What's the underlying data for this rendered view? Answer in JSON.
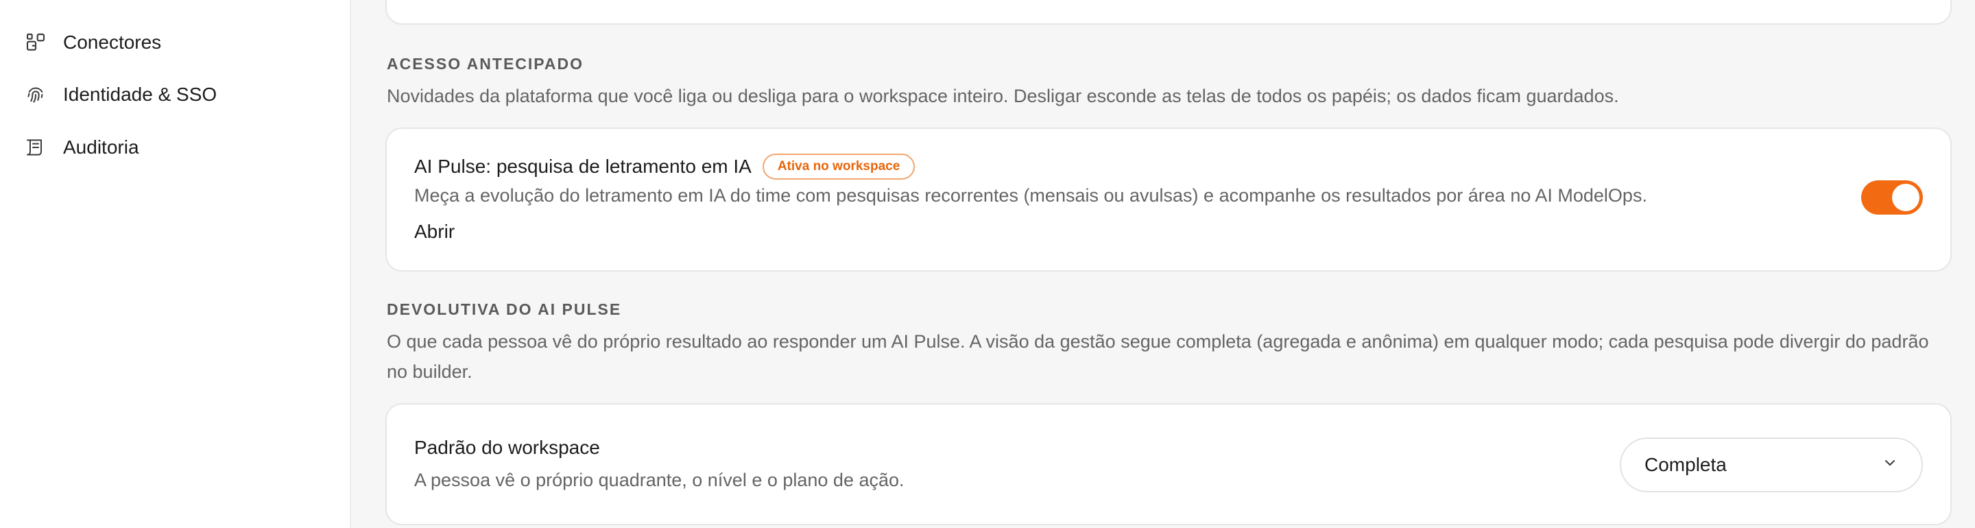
{
  "sidebar": {
    "items": [
      {
        "label": "Conectores",
        "icon": "connectors-icon"
      },
      {
        "label": "Identidade & SSO",
        "icon": "fingerprint-icon"
      },
      {
        "label": "Auditoria",
        "icon": "audit-log-icon"
      }
    ]
  },
  "early_access": {
    "title": "ACESSO ANTECIPADO",
    "description": "Novidades da plataforma que você liga ou desliga para o workspace inteiro. Desligar esconde as telas de todos os papéis; os dados ficam guardados.",
    "feature": {
      "title": "AI Pulse: pesquisa de letramento em IA",
      "badge": "Ativa no workspace",
      "description": "Meça a evolução do letramento em IA do time com pesquisas recorrentes (mensais ou avulsas) e acompanhe os resultados por área no AI ModelOps.",
      "link": "Abrir",
      "enabled": true
    }
  },
  "feedback": {
    "title": "DEVOLUTIVA DO AI PULSE",
    "description": "O que cada pessoa vê do próprio resultado ao responder um AI Pulse. A visão da gestão segue completa (agregada e anônima) em qualquer modo; cada pesquisa pode divergir do padrão no builder.",
    "default": {
      "title": "Padrão do workspace",
      "description": "A pessoa vê o próprio quadrante, o nível e o plano de ação.",
      "selected": "Completa"
    }
  },
  "colors": {
    "accent": "#f26a12",
    "badge_text": "#e8650a",
    "badge_border": "#f2a56f"
  }
}
